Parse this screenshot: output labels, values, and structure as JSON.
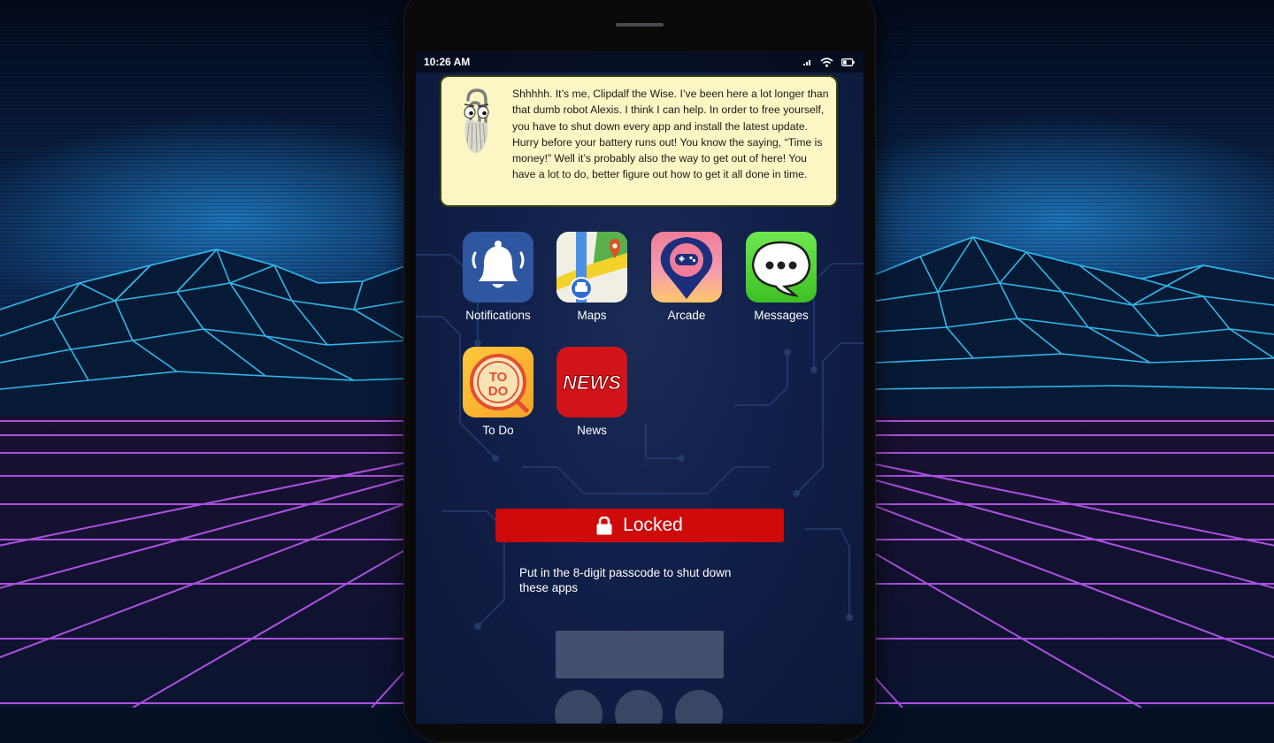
{
  "status_bar": {
    "time": "10:26 AM",
    "icons": [
      "signal-icon",
      "wifi-icon",
      "battery-icon"
    ]
  },
  "assistant": {
    "character_icon": "paperclip-assistant-icon",
    "message": "Shhhhh. It’s me, Clipdalf the Wise. I’ve been here a lot longer than that dumb robot Alexis. I think I can help. In order to free yourself, you have to shut down every app and install the latest update. Hurry before your battery runs out! You know the saying, “Time is money!” Well it’s probably also the way to get out of here! You have a lot to do, better figure out how to get it all done in time."
  },
  "apps": [
    {
      "label": "Notifications",
      "icon": "bell-icon"
    },
    {
      "label": "Maps",
      "icon": "map-icon"
    },
    {
      "label": "Arcade",
      "icon": "gamepad-pin-icon"
    },
    {
      "label": "Messages",
      "icon": "speech-bubble-icon"
    },
    {
      "label": "To Do",
      "icon": "todo-icon",
      "icon_text": "TO DO"
    },
    {
      "label": "News",
      "icon": "news-icon",
      "icon_text": "NEWS"
    }
  ],
  "lock": {
    "label": "Locked",
    "icon": "lock-icon",
    "instructions": "Put in the 8-digit passcode to shut down these apps"
  },
  "colors": {
    "bubble_bg": "#fbf6c4",
    "locked_red": "#cf0a0a",
    "screen_bg": "#11204a"
  }
}
